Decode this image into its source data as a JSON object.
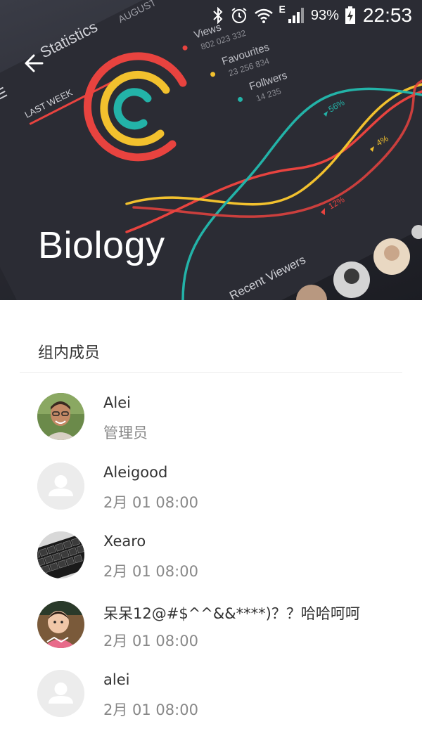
{
  "status_bar": {
    "network_type": "E",
    "battery_percent": "93%",
    "time": "22:53",
    "icons": [
      "bluetooth-icon",
      "alarm-icon",
      "wifi-icon",
      "signal-icon",
      "battery-charging-icon"
    ]
  },
  "header": {
    "title": "Biology",
    "back_icon": "arrow-left-icon",
    "artwork": {
      "app_title": "Statistics",
      "tabs": [
        "LAST WEEK",
        "AUGUST"
      ],
      "stats": [
        {
          "label": "Views",
          "value": "802 023 332",
          "color": "#e8433f"
        },
        {
          "label": "Favourites",
          "value": "23 256 834",
          "color": "#f2c12e"
        },
        {
          "label": "Follwers",
          "value": "14 235",
          "color": "#23b3a8"
        }
      ],
      "percent_labels": [
        "56%",
        "4%",
        "12%"
      ],
      "recent_label": "Recent Viewers"
    }
  },
  "members": {
    "title": "组内成员",
    "list": [
      {
        "name": "Alei",
        "sub": "管理员",
        "avatar": "photo-man"
      },
      {
        "name": "Aleigood",
        "sub": "2月 01 08:00",
        "avatar": "default"
      },
      {
        "name": "Xearo",
        "sub": "2月 01 08:00",
        "avatar": "keyboard"
      },
      {
        "name": "呆呆12@#$^^&&****)？？哈哈呵呵",
        "sub": "2月 01 08:00",
        "avatar": "photo-baby"
      },
      {
        "name": "alei",
        "sub": "2月 01 08:00",
        "avatar": "default"
      }
    ]
  }
}
